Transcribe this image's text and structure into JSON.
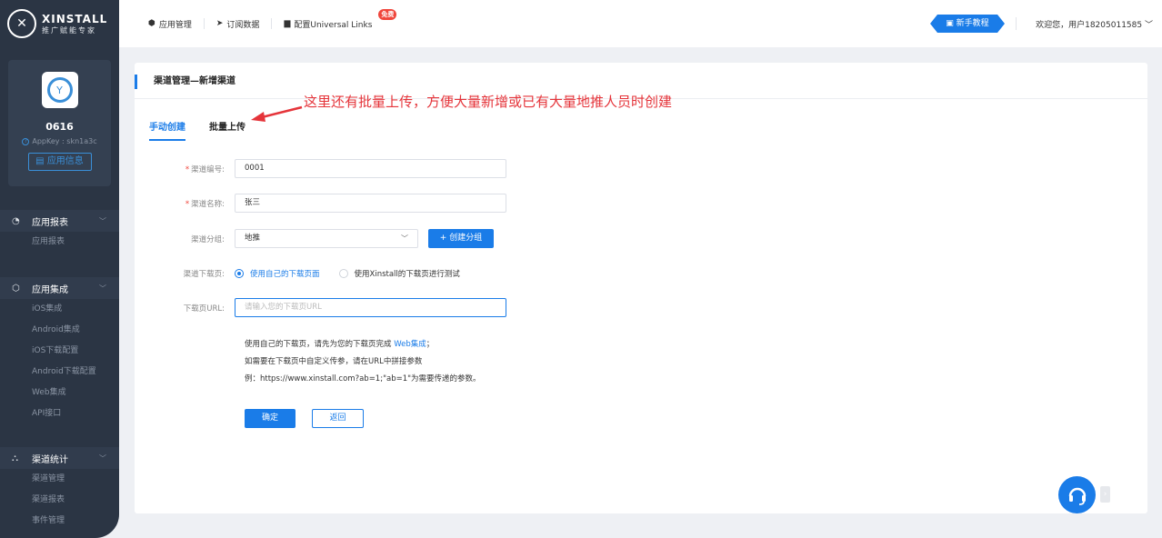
{
  "brand": {
    "name": "XINSTALL",
    "tagline": "推广赋能专家"
  },
  "app": {
    "name": "0616",
    "appkey": "AppKey : skn1a3c",
    "info_button": "应用信息"
  },
  "sidebar": {
    "groups": [
      {
        "label": "应用报表",
        "icon": "chart-icon",
        "items": [
          "应用报表"
        ]
      },
      {
        "label": "应用集成",
        "icon": "integrate-icon",
        "items": [
          "iOS集成",
          "Android集成",
          "iOS下载配置",
          "Android下载配置",
          "Web集成",
          "API接口"
        ]
      },
      {
        "label": "渠道统计",
        "icon": "channel-icon",
        "items": [
          "渠道管理",
          "渠道报表",
          "事件管理"
        ]
      }
    ]
  },
  "topbar": {
    "nav": [
      {
        "label": "应用管理",
        "icon": "cube-icon"
      },
      {
        "label": "订阅数据",
        "icon": "send-icon"
      },
      {
        "label": "配置Universal Links",
        "icon": "briefcase-icon"
      }
    ],
    "free_badge": "免费",
    "tutorial": "新手教程",
    "welcome": "欢迎您，用户18205011585"
  },
  "page": {
    "title": "渠道管理—新增渠道",
    "annotation": "这里还有批量上传，方便大量新增或已有大量地推人员时创建",
    "tabs": [
      "手动创建",
      "批量上传"
    ],
    "form": {
      "channel_code_label": "渠道编号:",
      "channel_code_value": "0001",
      "channel_name_label": "渠道名称:",
      "channel_name_value": "张三",
      "channel_group_label": "渠道分组:",
      "channel_group_value": "地推",
      "create_group_button": "+ 创建分组",
      "download_page_label": "渠道下载页:",
      "download_options": [
        "使用自己的下载页面",
        "使用Xinstall的下载页进行测试"
      ],
      "download_url_label": "下载页URL:",
      "download_url_placeholder": "请输入您的下载页URL"
    },
    "hints": {
      "line1_prefix": "使用自己的下载页，请先为您的下载页完成",
      "line1_link": "Web集成",
      "line1_suffix": "；",
      "line2": "如需要在下载页中自定义传参，请在URL中拼接参数",
      "line3": "例：https://www.xinstall.com?ab=1;\"ab=1\"为需要传递的参数。"
    },
    "confirm_button": "确定",
    "back_button": "返回"
  },
  "colors": {
    "accent": "#1a7ce8",
    "sidebar_bg": "#2b3544",
    "annotation": "#e5343a"
  }
}
